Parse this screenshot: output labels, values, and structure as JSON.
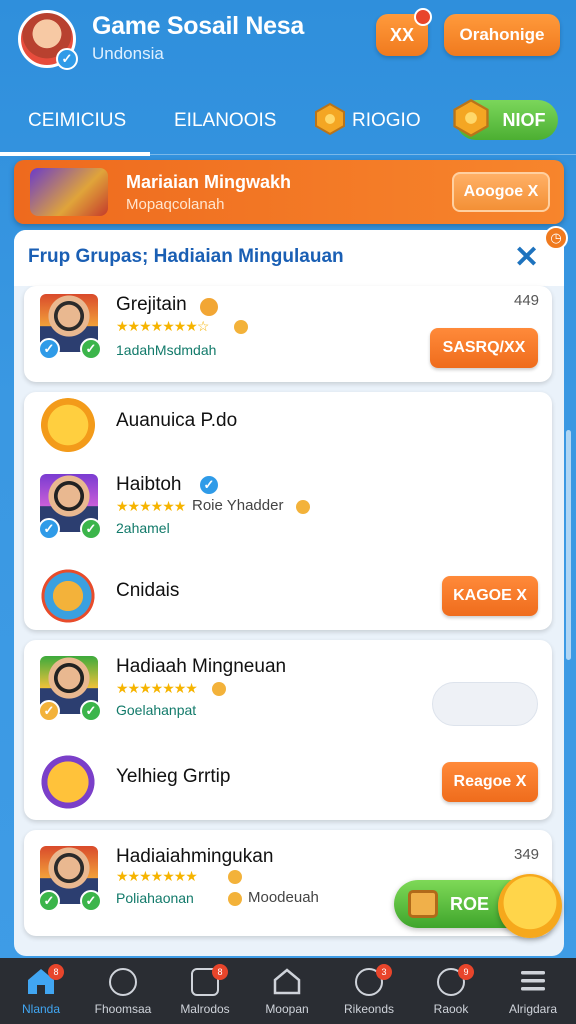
{
  "header": {
    "app_title": "Game Sosail Nesa",
    "app_subtitle": "Undonsia",
    "button_x_label": "XX",
    "button_cta_label": "Orahonige"
  },
  "tabs": [
    {
      "label": "CEIMICIUS"
    },
    {
      "label": "EILANOOIS"
    },
    {
      "label": "RIOGIO"
    },
    {
      "label": "NIOF"
    }
  ],
  "banner": {
    "title": "Mariaian Mingwakh",
    "subtitle": "Mopaqcolanah",
    "button_label": "Aoogoe X"
  },
  "panel": {
    "title": "Frup Grupas; Hadiaian Mingulauan"
  },
  "items": [
    {
      "name": "Grejitain",
      "stars": "★★★★★★★☆",
      "meta": "1adahMsdmdah",
      "count": "449",
      "button": "SASRQ/XX"
    },
    {
      "name": "Auanuica P.do"
    },
    {
      "name": "Haibtoh",
      "stars": "★★★★★★",
      "meta_grey": "Roie Yhadder",
      "meta": "2ahamel"
    },
    {
      "name": "Cnidais",
      "button": "KAGOE X"
    },
    {
      "name": "Hadiaah Mingneuan",
      "stars": "★★★★★★★",
      "meta": "Goelahanpat"
    },
    {
      "name": "Yelhieg Grrtip",
      "button": "Reagoe X"
    },
    {
      "name": "Hadiaiahmingukan",
      "stars": "★★★★★★★",
      "meta": "Poliahaonan",
      "meta_grey": "Moodeuah",
      "count": "349"
    }
  ],
  "fab": {
    "label": "ROE"
  },
  "bottom_nav": [
    {
      "label": "Nlanda",
      "badge": "8"
    },
    {
      "label": "Fhoomsaa"
    },
    {
      "label": "Malrodos",
      "badge": "8"
    },
    {
      "label": "Moopan"
    },
    {
      "label": "Rikeonds",
      "badge": "3"
    },
    {
      "label": "Raook",
      "badge": "9"
    },
    {
      "label": "Alrigdara"
    }
  ],
  "colors": {
    "background": "#3a98e2",
    "accent_orange": "#f07a1e",
    "accent_green": "#4caf32",
    "panel_title": "#1a5fb4"
  }
}
